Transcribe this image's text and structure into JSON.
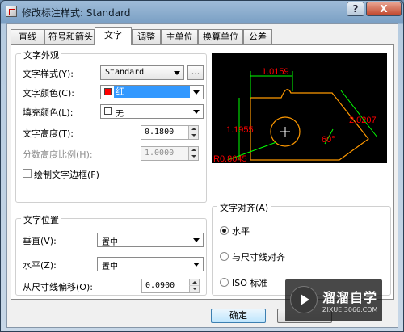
{
  "window": {
    "title": "修改标注样式: Standard",
    "help_label": "?",
    "close_label": "X"
  },
  "tabs": [
    {
      "label": "直线"
    },
    {
      "label": "符号和箭头"
    },
    {
      "label": "文字"
    },
    {
      "label": "调整"
    },
    {
      "label": "主单位"
    },
    {
      "label": "换算单位"
    },
    {
      "label": "公差"
    }
  ],
  "active_tab": "文字",
  "appearance": {
    "group_title": "文字外观",
    "style_label": "文字样式(Y):",
    "style_value": "Standard",
    "style_browse_label": "...",
    "color_label": "文字颜色(C):",
    "color_value": "红",
    "color_swatch": "#ff0000",
    "fill_label": "填充颜色(L):",
    "fill_value": "无",
    "height_label": "文字高度(T):",
    "height_value": "0.1800",
    "fraction_label": "分数高度比例(H):",
    "fraction_value": "1.0000",
    "frame_label": "绘制文字边框(F)",
    "frame_checked": false
  },
  "placement": {
    "group_title": "文字位置",
    "vertical_label": "垂直(V):",
    "vertical_value": "置中",
    "horizontal_label": "水平(Z):",
    "horizontal_value": "置中",
    "offset_label": "从尺寸线偏移(O):",
    "offset_value": "0.0900"
  },
  "alignment": {
    "group_title": "文字对齐(A)",
    "options": [
      {
        "label": "水平",
        "selected": true
      },
      {
        "label": "与尺寸线对齐",
        "selected": false
      },
      {
        "label": "ISO 标准",
        "selected": false
      }
    ]
  },
  "preview": {
    "labels": {
      "top": "1.0159",
      "left": "1.1955",
      "right": "2.0207",
      "angle": "60°",
      "radius": "R0.8045"
    },
    "colors": {
      "background": "#000000",
      "text": "#ff0000",
      "dim": "#00ff00",
      "outline": "#ff9900",
      "circle": "#ffffff"
    }
  },
  "footer": {
    "ok_label": "确定"
  },
  "watermark": {
    "title": "溜溜自学",
    "subtitle": "ZIXUE.3066.COM"
  }
}
